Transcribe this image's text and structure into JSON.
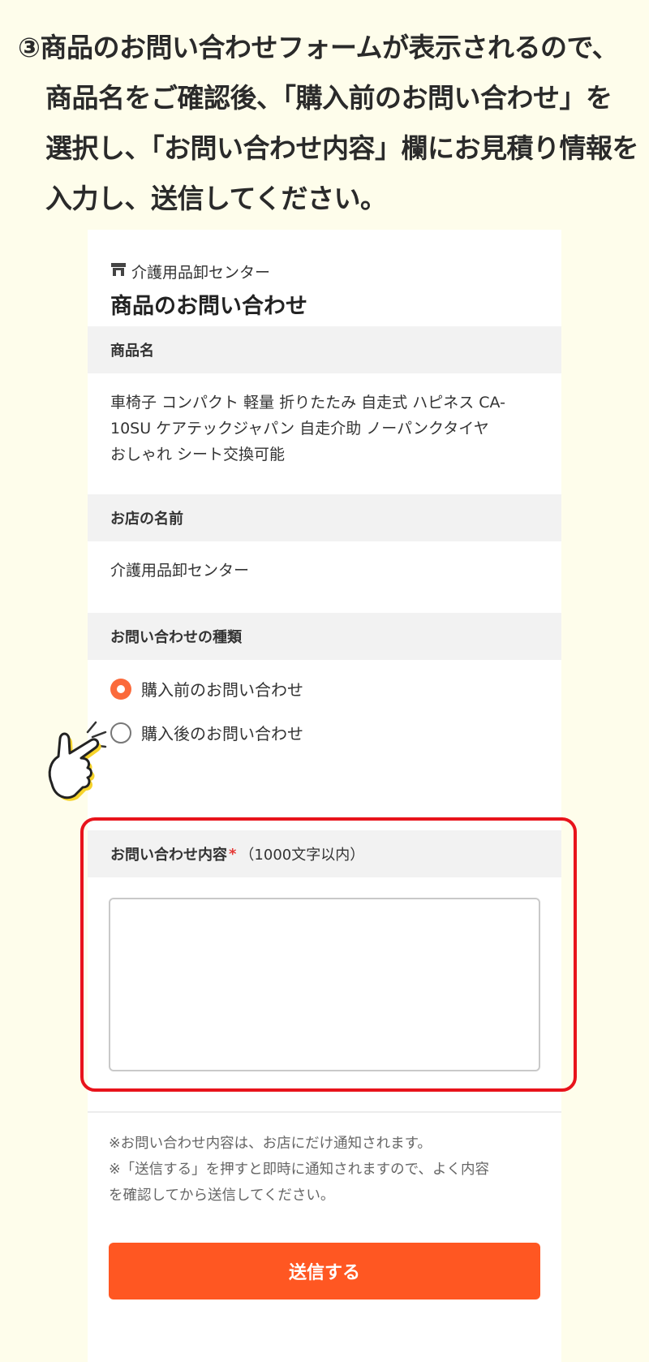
{
  "instruction": {
    "lines": [
      "③商品のお問い合わせフォームが表示されるので、",
      "商品名をご確認後、「購入前のお問い合わせ」を",
      "選択し、「お問い合わせ内容」欄にお見積り情報を",
      "入力し、送信してください。"
    ]
  },
  "form": {
    "shop_name": "介護用品卸センター",
    "title": "商品のお問い合わせ",
    "product": {
      "label": "商品名",
      "lines": [
        "車椅子 コンパクト 軽量 折りたたみ 自走式 ハピネス CA-",
        "10SU ケアテックジャパン 自走介助 ノーパンクタイヤ",
        "おしゃれ シート交換可能"
      ]
    },
    "store": {
      "label": "お店の名前",
      "value": "介護用品卸センター"
    },
    "inquiry_type": {
      "label": "お問い合わせの種類",
      "options": [
        {
          "label": "購入前のお問い合わせ",
          "selected": true
        },
        {
          "label": "購入後のお問い合わせ",
          "selected": false
        }
      ]
    },
    "content": {
      "label": "お問い合わせ内容",
      "required_mark": "*",
      "note": "（1000文字以内）",
      "value": ""
    },
    "notes": [
      "※お問い合わせ内容は、お店にだけ通知されます。",
      "※「送信する」を押すと即時に通知されますので、よく内容",
      "を確認してから送信してください。"
    ],
    "submit_label": "送信する"
  },
  "colors": {
    "page_background": "#fefdeb",
    "accent": "#ff5722",
    "radio_selected": "#fb6a3b",
    "highlight": "#e8131b",
    "required": "#e53935"
  },
  "icons": [
    "store-icon",
    "pointing-hand-icon"
  ]
}
